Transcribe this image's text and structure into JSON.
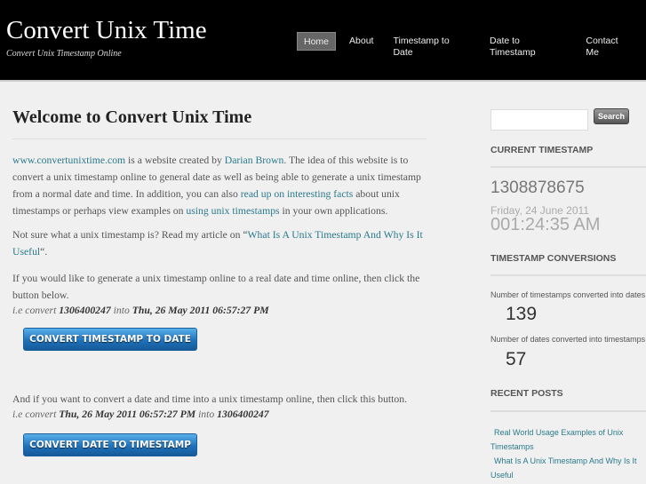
{
  "header": {
    "title": "Convert Unix Time",
    "tagline": "Convert Unix Timestamp Online",
    "nav": [
      "Home",
      "About",
      "Timestamp to Date",
      "Date to Timestamp",
      "Contact Me"
    ]
  },
  "main": {
    "title": "Welcome to Convert Unix Time",
    "p1": {
      "link_site": "www.convertunixtime.com",
      "t1": " is a website created by ",
      "link_author": "Darian Brown",
      "t2": ". The idea of this website is to convert a unix timestamp online to general date as well as being able to generate a unix timestamp from a normal date and time. In addition, you can also ",
      "link_facts": "read up on interesting facts",
      "t3": " about unix timestamps or perhaps view examples on ",
      "link_using": "using unix timestamps",
      "t4": " in your own applications."
    },
    "p2": {
      "t1": "Not sure what a unix timestamp is? Read my article on “",
      "link": "What Is A Unix Timestamp And Why Is It Useful",
      "t2": "“."
    },
    "p3": "If you would like to generate a unix timestamp online to a real date and time online, then click the button below.",
    "ex1": {
      "prefix": "i.e convert ",
      "ts": "1306400247",
      "mid": " into ",
      "date": "Thu, 26 May 2011 06:57:27 PM"
    },
    "btn1": "CONVERT TIMESTAMP TO DATE",
    "p4": "And if you want to convert a date and time into a unix timestamp online, then click this button.",
    "ex2": {
      "prefix": "i.e convert ",
      "date": "Thu, 26 May 2011 06:57:27 PM",
      "mid": " into ",
      "ts": "1306400247"
    },
    "btn2": "CONVERT DATE TO TIMESTAMP"
  },
  "sidebar": {
    "search_button": "Search",
    "search_value": "",
    "current_title": "CURRENT TIMESTAMP",
    "timestamp": "1308878675",
    "date": "Friday, 24 June 2011",
    "time": "001:24:35 AM",
    "conv_title": "TIMESTAMP CONVERSIONS",
    "conv1_label": "Number of timestamps converted into dates",
    "conv1_value": "139",
    "conv2_label": "Number of dates converted into timestamps",
    "conv2_value": "57",
    "recent_title": "RECENT POSTS",
    "posts": [
      "Real World Usage Examples of Unix Timestamps",
      "What Is A Unix Timestamp And Why Is It Useful"
    ]
  }
}
